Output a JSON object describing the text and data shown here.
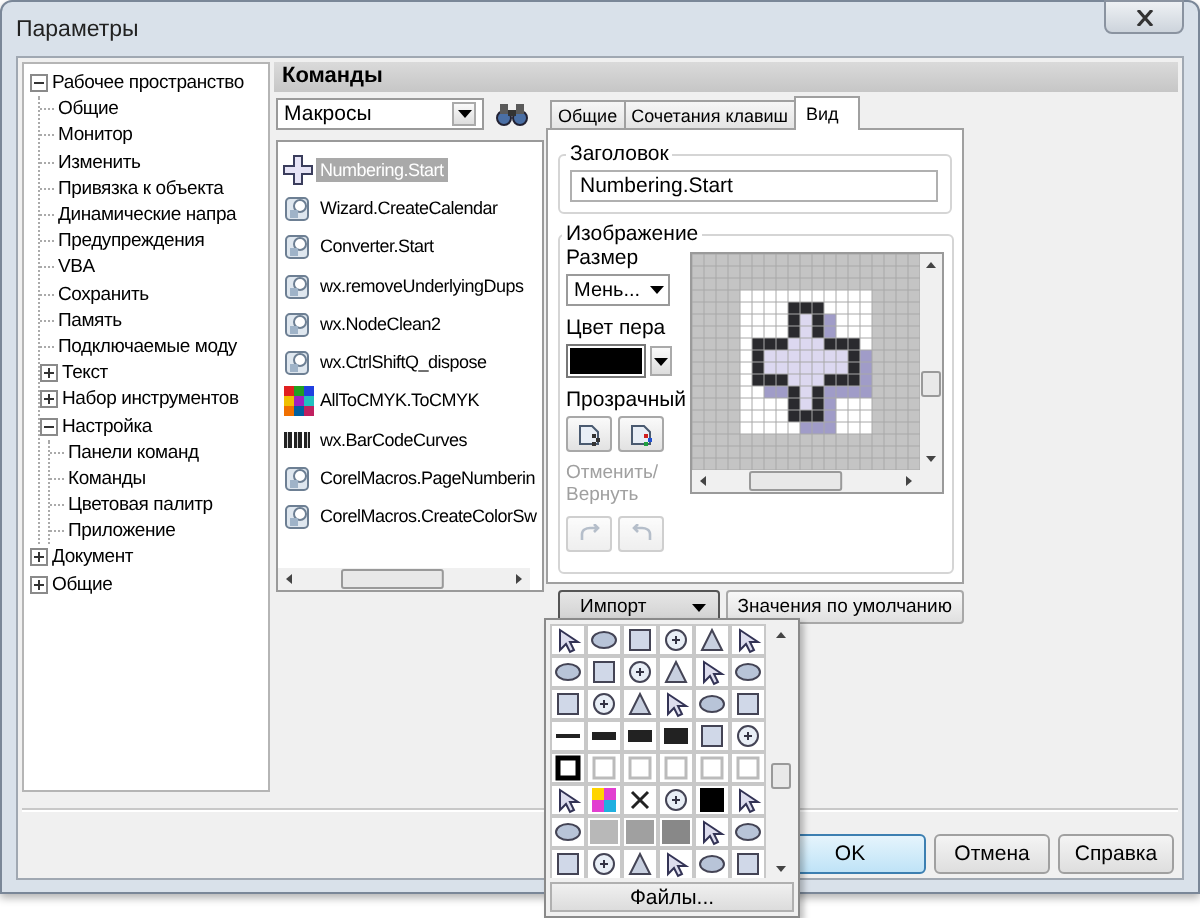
{
  "window": {
    "title": "Параметры"
  },
  "tree": [
    {
      "label": "Рабочее пространство",
      "expanded": true,
      "children": [
        {
          "label": "Общие"
        },
        {
          "label": "Монитор"
        },
        {
          "label": "Изменить"
        },
        {
          "label": "Привязка к объекта"
        },
        {
          "label": "Динамические напра"
        },
        {
          "label": "Предупреждения"
        },
        {
          "label": "VBA"
        },
        {
          "label": "Сохранить"
        },
        {
          "label": "Память"
        },
        {
          "label": "Подключаемые моду"
        },
        {
          "label": "Текст",
          "expanded": false
        },
        {
          "label": "Набор инструментов",
          "expanded": false
        },
        {
          "label": "Настройка",
          "expanded": true,
          "children": [
            {
              "label": "Панели команд"
            },
            {
              "label": "Команды"
            },
            {
              "label": "Цветовая палитр"
            },
            {
              "label": "Приложение"
            }
          ]
        }
      ]
    },
    {
      "label": "Документ",
      "expanded": false
    },
    {
      "label": "Общие",
      "expanded": false
    }
  ],
  "section_title": "Команды",
  "category": {
    "value": "Макросы"
  },
  "commands": [
    {
      "label": "Numbering.Start",
      "kind": "cross",
      "selected": true
    },
    {
      "label": "Wizard.CreateCalendar",
      "kind": "macro",
      "selected": false
    },
    {
      "label": "Converter.Start",
      "kind": "macro",
      "selected": false
    },
    {
      "label": "wx.removeUnderlyingDups",
      "kind": "macro",
      "selected": false
    },
    {
      "label": "wx.NodeClean2",
      "kind": "macro",
      "selected": false
    },
    {
      "label": "wx.CtrlShiftQ_dispose",
      "kind": "macro",
      "selected": false
    },
    {
      "label": "AllToCMYK.ToCMYK",
      "kind": "palette",
      "selected": false
    },
    {
      "label": "wx.BarCodeCurves",
      "kind": "barcode",
      "selected": false
    },
    {
      "label": "CorelMacros.PageNumberin",
      "kind": "macro",
      "selected": false
    },
    {
      "label": "CorelMacros.CreateColorSw",
      "kind": "macro",
      "selected": false
    }
  ],
  "tabs": [
    {
      "label": "Общие",
      "selected": false
    },
    {
      "label": "Сочетания клавиш",
      "selected": false
    },
    {
      "label": "Вид",
      "selected": true
    }
  ],
  "caption": {
    "label": "Заголовок",
    "value": "Numbering.Start"
  },
  "image": {
    "label": "Изображение",
    "size_label": "Размер",
    "size_value": "Мень...",
    "pen_label": "Цвет пера",
    "transparent_label": "Прозрачный",
    "undo_label": "Отменить/ Вернуть",
    "undo_disabled": true
  },
  "import_button": "Импорт",
  "defaults_button": "Значения по умолчанию",
  "files_button": "Файлы...",
  "buttons": [
    {
      "label": "OK",
      "default": true
    },
    {
      "label": "Отмена",
      "default": false
    },
    {
      "label": "Справка",
      "default": false
    }
  ]
}
